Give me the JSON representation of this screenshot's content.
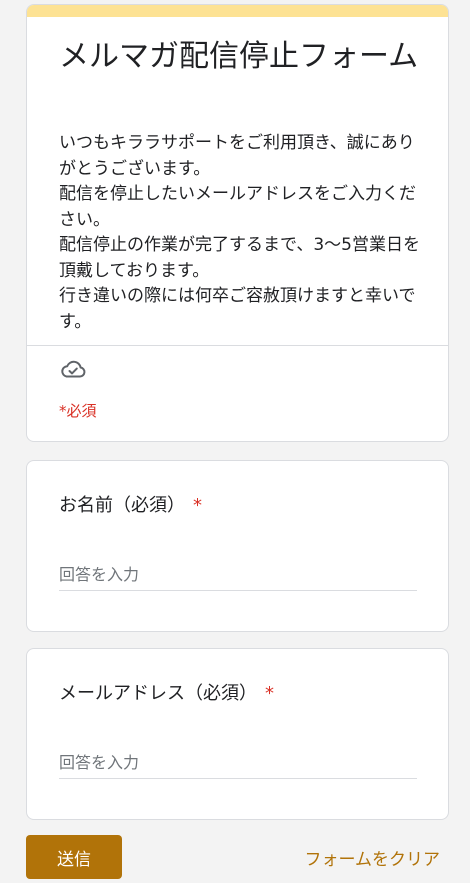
{
  "form": {
    "title": "メルマガ配信停止フォーム",
    "description": "いつもキララサポートをご利用頂き、誠にありがとうございます。\n配信を停止したいメールアドレスをご入力ください。\n配信停止の作業が完了するまで、3〜5営業日を頂戴しております。\n行き違いの際には何卒ご容赦頂けますと幸いです。",
    "save_status_icon": "cloud-check-icon",
    "required_note": "*必須"
  },
  "questions": [
    {
      "label": "お名前（必須）",
      "required_mark": "*",
      "placeholder": "回答を入力"
    },
    {
      "label": "メールアドレス（必須）",
      "required_mark": "*",
      "placeholder": "回答を入力"
    }
  ],
  "actions": {
    "submit_label": "送信",
    "clear_label": "フォームをクリア"
  },
  "colors": {
    "accent": "#b17309",
    "header_band": "#fde293",
    "required": "#d93025"
  }
}
